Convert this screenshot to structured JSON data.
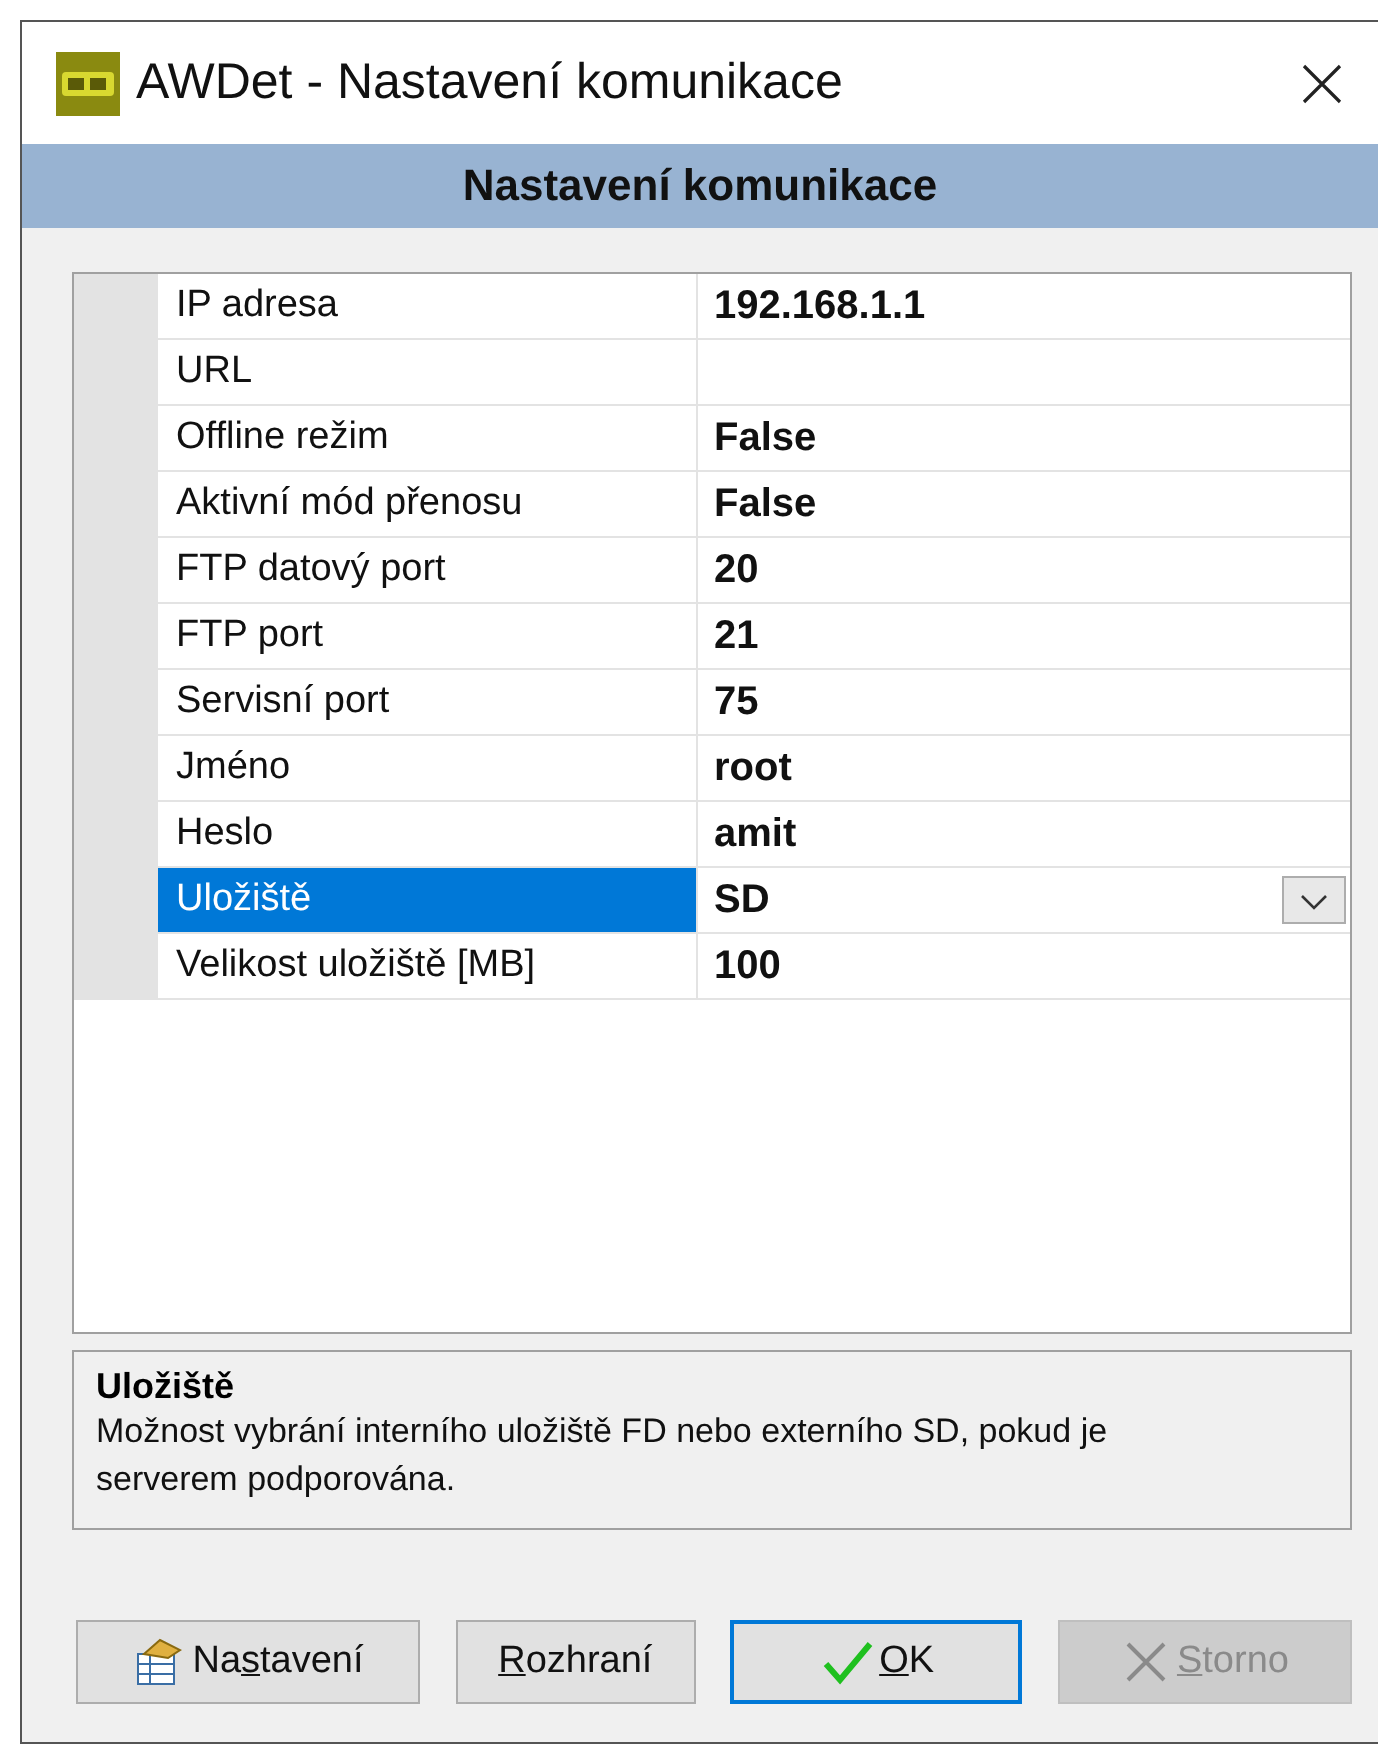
{
  "window": {
    "title": "AWDet - Nastavení komunikace"
  },
  "header": {
    "title": "Nastavení komunikace"
  },
  "properties": [
    {
      "name": "IP adresa",
      "value": "192.168.1.1",
      "selected": false
    },
    {
      "name": "URL",
      "selected": false
    },
    {
      "name": "Offline režim",
      "value": "False",
      "selected": false
    },
    {
      "name": "Aktivní mód přenosu",
      "value": "False",
      "selected": false
    },
    {
      "name": "FTP datový port",
      "value": "20",
      "selected": false
    },
    {
      "name": "FTP port",
      "value": "21",
      "selected": false
    },
    {
      "name": "Servisní port",
      "value": "75",
      "selected": false
    },
    {
      "name": "Jméno",
      "value": "root",
      "selected": false
    },
    {
      "name": "Heslo",
      "value": "amit",
      "selected": false
    },
    {
      "name": "Uložiště",
      "value": "SD",
      "selected": true
    },
    {
      "name": "Velikost uložiště [MB]",
      "value": "100",
      "selected": false
    }
  ],
  "description": {
    "title": "Uložiště",
    "text": "Možnost vybrání interního uložiště FD nebo externího SD, pokud je serverem podporována."
  },
  "buttons": [
    {
      "kind": "settings",
      "before": "Na",
      "key": "s",
      "after": "tavení",
      "default": false,
      "disabled": false
    },
    {
      "kind": "plain",
      "key": "R",
      "after": "ozhraní",
      "default": false,
      "disabled": false
    },
    {
      "kind": "ok",
      "key": "O",
      "after": "K",
      "default": true,
      "disabled": false
    },
    {
      "kind": "cancel",
      "key": "S",
      "after": "torno",
      "default": false,
      "disabled": true
    }
  ]
}
